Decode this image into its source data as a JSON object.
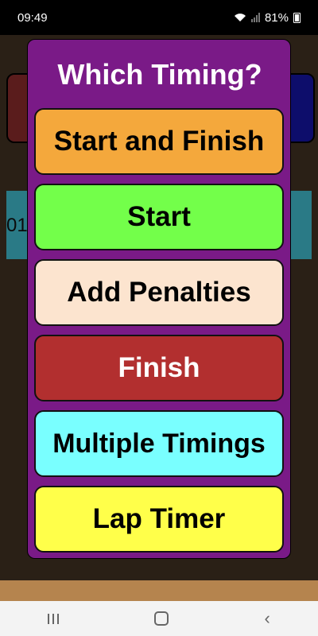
{
  "status_bar": {
    "time": "09:49",
    "battery_percent": "81%"
  },
  "background": {
    "partial_text": "01"
  },
  "dialog": {
    "title": "Which Timing?",
    "options": [
      {
        "label": "Start and Finish",
        "color": "#f4a83c"
      },
      {
        "label": "Start",
        "color": "#73ff4a"
      },
      {
        "label": "Add Penalties",
        "color": "#fce4cf"
      },
      {
        "label": "Finish",
        "color": "#b22f2f"
      },
      {
        "label": "Multiple Timings",
        "color": "#79ffff"
      },
      {
        "label": "Lap Timer",
        "color": "#ffff4a"
      }
    ]
  },
  "nav_bar": {
    "recent_icon": "recent-apps-icon",
    "home_icon": "home-icon",
    "back_icon": "back-icon"
  }
}
